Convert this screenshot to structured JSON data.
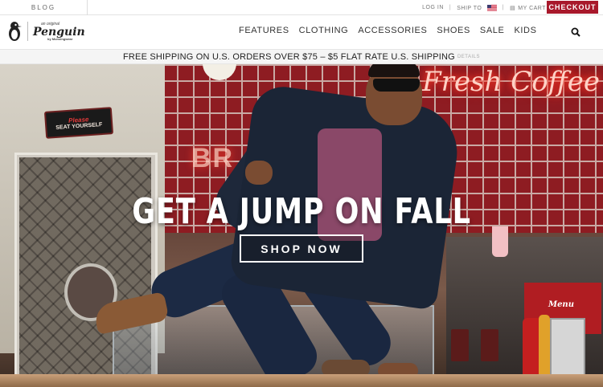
{
  "utility_bar": {
    "blog_label": "BLOG",
    "login_label": "LOG IN",
    "ship_to_label": "SHIP TO",
    "cart_label": "MY CART",
    "checkout_label": "CHECKOUT",
    "checkout_color": "#a8182b"
  },
  "header": {
    "logo": {
      "tagline": "an original",
      "brand": "Penguin",
      "subline": "by Munsingwear"
    },
    "nav": [
      "FEATURES",
      "CLOTHING",
      "ACCESSORIES",
      "SHOES",
      "SALE",
      "KIDS"
    ],
    "search_icon": "search-icon"
  },
  "promo": {
    "text": "FREE SHIPPING ON U.S. ORDERS OVER $75 – $5 FLAT RATE U.S. SHIPPING",
    "details_label": "DETAILS"
  },
  "hero": {
    "headline": "GET A JUMP ON FALL",
    "cta_label": "SHOP NOW",
    "sign_top": "Please",
    "sign_bottom": "SEAT YOURSELF",
    "neon_text": "Fresh Coffee",
    "neon_left": "BR",
    "menu_label": "Menu"
  }
}
